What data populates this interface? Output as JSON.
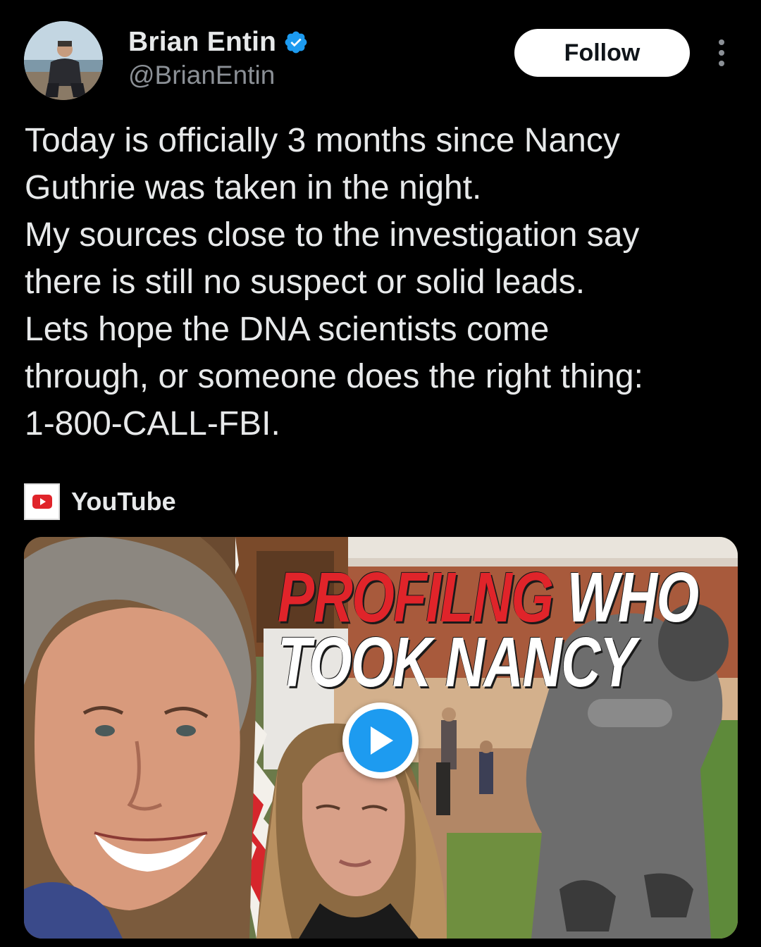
{
  "author": {
    "display_name": "Brian Entin",
    "handle": "@BrianEntin",
    "avatar_icon": "profile-photo",
    "verified_icon": "verified-badge-icon"
  },
  "actions": {
    "follow_label": "Follow",
    "more_icon": "more-options-icon"
  },
  "tweet": {
    "lines": [
      "Today is officially 3 months since Nancy",
      "Guthrie was taken in the night.",
      "My sources close to the investigation say",
      "there is still no suspect or solid leads.",
      "Lets hope the DNA scientists come",
      "through, or someone does the right thing:",
      "1-800-CALL-FBI."
    ]
  },
  "link_card": {
    "source": "YouTube",
    "source_icon": "youtube-logo-icon",
    "thumbnail": {
      "title_part1": "PROFILNG",
      "title_part2": "WHO",
      "title_line2": "TOOK NANCY"
    },
    "play_icon": "play-icon"
  },
  "colors": {
    "background": "#000000",
    "text": "#e7e9ea",
    "secondary_text": "#8b9096",
    "verified_blue": "#1d9bf0",
    "youtube_red": "#e0242a"
  }
}
